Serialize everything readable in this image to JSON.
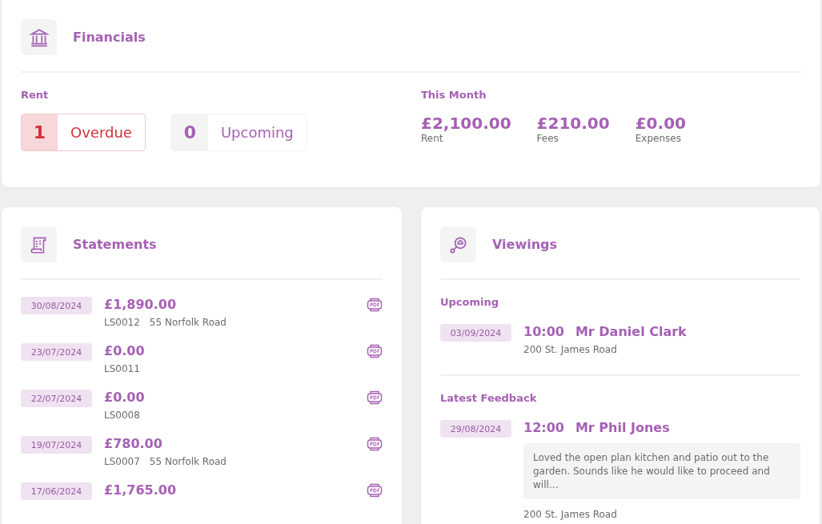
{
  "financials": {
    "title": "Financials",
    "rent": {
      "label": "Rent",
      "counters": [
        {
          "kind": "overdue",
          "count": "1",
          "label": "Overdue"
        },
        {
          "kind": "upcoming",
          "count": "0",
          "label": "Upcoming"
        }
      ]
    },
    "this_month": {
      "label": "This Month",
      "figures": [
        {
          "amount": "£2,100.00",
          "label": "Rent"
        },
        {
          "amount": "£210.00",
          "label": "Fees"
        },
        {
          "amount": "£0.00",
          "label": "Expenses"
        }
      ]
    }
  },
  "statements": {
    "title": "Statements",
    "rows": [
      {
        "date": "30/08/2024",
        "amount": "£1,890.00",
        "ref": "LS0012",
        "address": "55 Norfolk Road"
      },
      {
        "date": "23/07/2024",
        "amount": "£0.00",
        "ref": "LS0011"
      },
      {
        "date": "22/07/2024",
        "amount": "£0.00",
        "ref": "LS0008"
      },
      {
        "date": "19/07/2024",
        "amount": "£780.00",
        "ref": "LS0007",
        "address": "55 Norfolk Road"
      },
      {
        "date": "17/06/2024",
        "amount": "£1,765.00"
      }
    ]
  },
  "viewings": {
    "title": "Viewings",
    "sections": [
      {
        "heading": "Upcoming",
        "items": [
          {
            "date": "03/09/2024",
            "time": "10:00",
            "name": "Mr Daniel Clark",
            "address": "200 St. James Road"
          }
        ]
      },
      {
        "heading": "Latest Feedback",
        "items": [
          {
            "date": "29/08/2024",
            "time": "12:00",
            "name": "Mr Phil Jones",
            "feedback": "Loved the open plan kitchen and patio out to the garden. Sounds like he would like to proceed and will…",
            "address": "200 St. James Road"
          }
        ]
      }
    ]
  }
}
